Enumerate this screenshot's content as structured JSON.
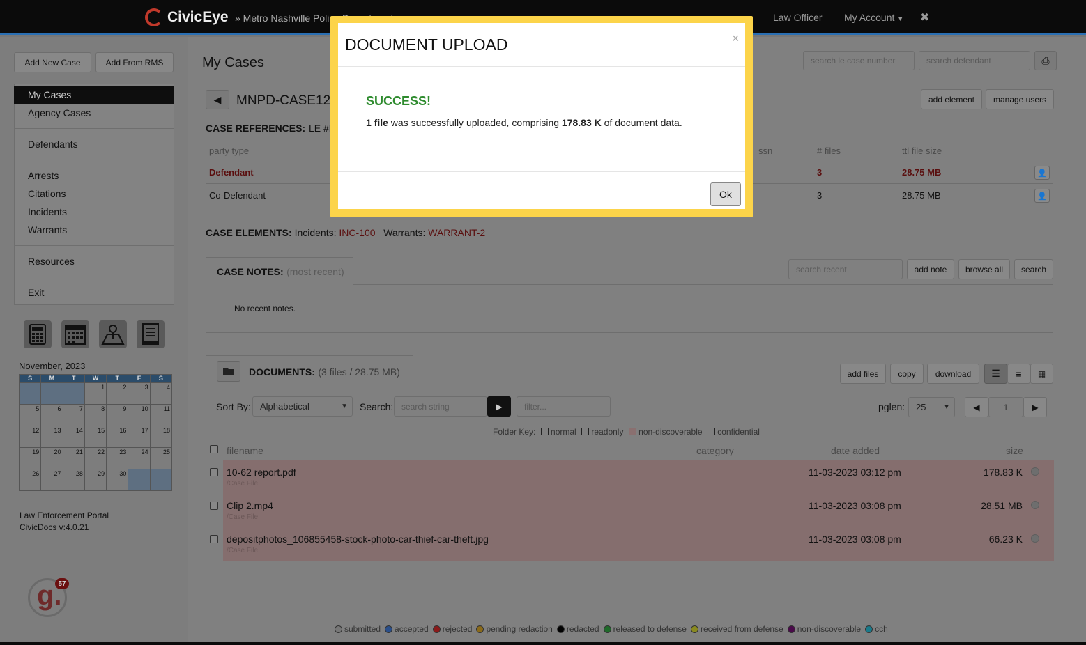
{
  "brand": {
    "name": "CivicEye",
    "agency": "» Metro Nashville Police Department"
  },
  "topnav": {
    "role": "Law Officer",
    "account": "My Account",
    "close": "✖"
  },
  "sidebar": {
    "add_new_case": "Add New Case",
    "add_from_rms": "Add From RMS",
    "items": [
      "My Cases",
      "Agency Cases",
      "Defendants",
      "Arrests",
      "Citations",
      "Incidents",
      "Warrants",
      "Resources",
      "Exit"
    ],
    "calendar": {
      "month": "November, 2023",
      "days": [
        "S",
        "M",
        "T",
        "W",
        "T",
        "F",
        "S"
      ],
      "weeks": [
        [
          "",
          "",
          "",
          "1",
          "2",
          "3",
          "4"
        ],
        [
          "5",
          "6",
          "7",
          "8",
          "9",
          "10",
          "11"
        ],
        [
          "12",
          "13",
          "14",
          "15",
          "16",
          "17",
          "18"
        ],
        [
          "19",
          "20",
          "21",
          "22",
          "23",
          "24",
          "25"
        ],
        [
          "26",
          "27",
          "28",
          "29",
          "30",
          "",
          ""
        ]
      ]
    },
    "footer_line1": "Law Enforcement Portal",
    "footer_line2": "CivicDocs v:4.0.21",
    "badge_count": "57"
  },
  "main": {
    "title": "My Cases",
    "search_case_placeholder": "search le case number",
    "search_defendant_placeholder": "search defendant",
    "case_id": "MNPD-CASE123",
    "add_element": "add element",
    "manage_users": "manage users",
    "case_references_label": "CASE REFERENCES:",
    "case_references_value": "LE #M",
    "party_headers": {
      "party_type": "party type",
      "ssn": "ssn",
      "files": "# files",
      "size": "ttl file size"
    },
    "parties": [
      {
        "type": "Defendant",
        "files": "3",
        "size": "28.75 MB"
      },
      {
        "type": "Co-Defendant",
        "files": "3",
        "size": "28.75 MB"
      }
    ],
    "case_elements_label": "CASE ELEMENTS:",
    "incidents_label": "Incidents:",
    "incident_value": "INC-100",
    "warrants_label": "Warrants:",
    "warrant_value": "WARRANT-2",
    "notes": {
      "label": "CASE NOTES:",
      "sub": "(most recent)",
      "search_placeholder": "search recent",
      "add_note": "add note",
      "browse_all": "browse all",
      "search": "search",
      "empty": "No recent notes."
    },
    "documents": {
      "label": "DOCUMENTS:",
      "summary": "(3 files / 28.75 MB)",
      "add_files": "add files",
      "copy": "copy",
      "download": "download",
      "sort_label": "Sort By:",
      "sort_value": "Alphabetical",
      "search_label": "Search:",
      "search_placeholder": "search string",
      "filter_placeholder": "filter...",
      "pglen_label": "pglen:",
      "pglen_value": "25",
      "page": "1",
      "folder_key_label": "Folder Key:",
      "folder_keys": [
        "normal",
        "readonly",
        "non-discoverable",
        "confidential"
      ],
      "headers": {
        "filename": "filename",
        "category": "category",
        "date": "date added",
        "size": "size"
      },
      "files": [
        {
          "name": "10-62 report.pdf",
          "folder": "/Case File",
          "date": "11-03-2023 03:12 pm",
          "size": "178.83 K"
        },
        {
          "name": "Clip 2.mp4",
          "folder": "/Case File",
          "date": "11-03-2023 03:08 pm",
          "size": "28.51 MB"
        },
        {
          "name": "depositphotos_106855458-stock-photo-car-thief-car-theft.jpg",
          "folder": "/Case File",
          "date": "11-03-2023 03:08 pm",
          "size": "66.23 K"
        }
      ]
    },
    "legend": [
      {
        "label": "submitted",
        "color": "#777777"
      },
      {
        "label": "accepted",
        "color": "#2a4f8a"
      },
      {
        "label": "rejected",
        "color": "#8a1a1a"
      },
      {
        "label": "pending redaction",
        "color": "#8a6a1a"
      },
      {
        "label": "redacted",
        "color": "#000000"
      },
      {
        "label": "released to defense",
        "color": "#1f6a2a"
      },
      {
        "label": "received from defense",
        "color": "#8a8a20"
      },
      {
        "label": "non-discoverable",
        "color": "#4a0a4a"
      },
      {
        "label": "cch",
        "color": "#1a7a8a"
      }
    ]
  },
  "modal": {
    "title": "DOCUMENT UPLOAD",
    "close": "×",
    "success": "SUCCESS!",
    "msg_count": "1 file",
    "msg_mid": " was successfully uploaded, comprising ",
    "msg_size": "178.83 K",
    "msg_end": " of document data.",
    "ok": "Ok"
  }
}
